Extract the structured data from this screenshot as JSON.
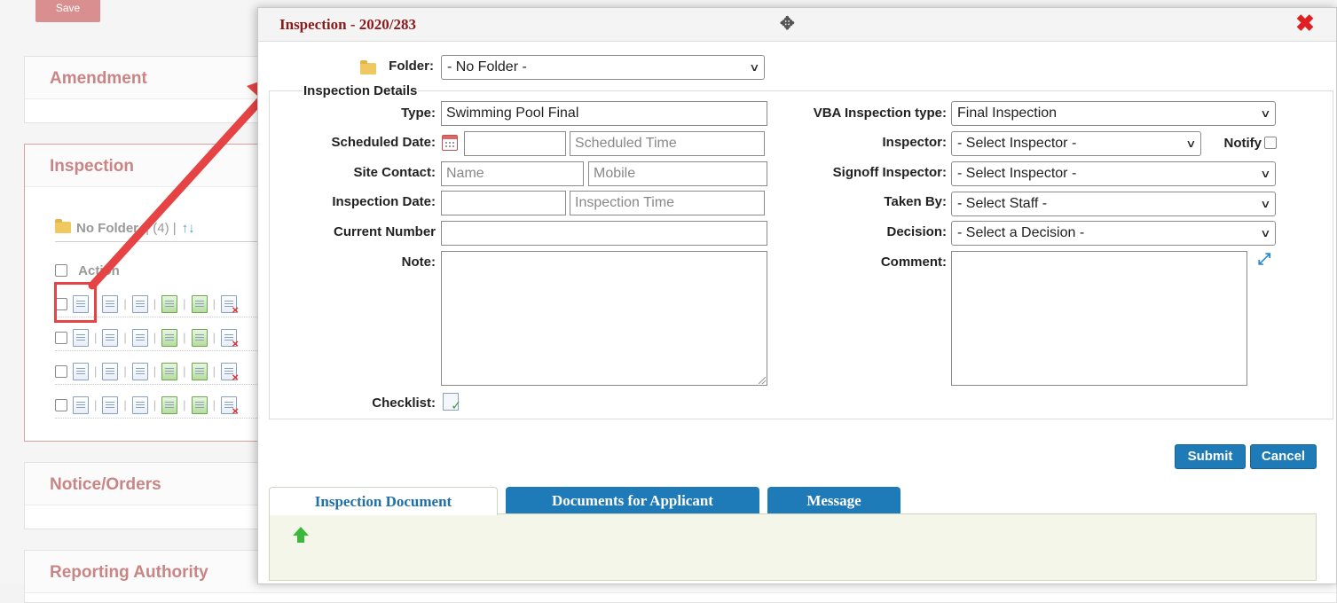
{
  "background": {
    "top_button_label": "Save",
    "panels": [
      {
        "id": "amendment",
        "title": "Amendment"
      },
      {
        "id": "inspection",
        "title": "Inspection"
      },
      {
        "id": "notice",
        "title": "Notice/Orders"
      },
      {
        "id": "reporting",
        "title": "Reporting Authority"
      }
    ],
    "folder_row": {
      "label": "No Folder",
      "count": "(4)",
      "sort_glyph": "↑↓"
    },
    "action_header": "Action",
    "rows": 4
  },
  "modal": {
    "title": "Inspection - 2020/283",
    "folder_label": "Folder:",
    "folder_value": "- No Folder -",
    "section_legend": "Inspection Details",
    "left": {
      "type_label": "Type:",
      "type_value": "Swimming Pool Final",
      "scheduled_date_label": "Scheduled Date:",
      "scheduled_date_value": "",
      "scheduled_time_placeholder": "Scheduled Time",
      "site_contact_label": "Site Contact:",
      "name_placeholder": "Name",
      "mobile_placeholder": "Mobile",
      "inspection_date_label": "Inspection Date:",
      "inspection_time_placeholder": "Inspection Time",
      "current_number_label": "Current Number",
      "note_label": "Note:",
      "checklist_label": "Checklist:"
    },
    "right": {
      "vba_type_label": "VBA Inspection type:",
      "vba_type_value": "Final Inspection",
      "inspector_label": "Inspector:",
      "inspector_value": "- Select Inspector -",
      "notify_label": "Notify",
      "signoff_label": "Signoff Inspector:",
      "signoff_value": "- Select Inspector -",
      "taken_by_label": "Taken By:",
      "taken_by_value": "- Select Staff -",
      "decision_label": "Decision:",
      "decision_value": "- Select a Decision -",
      "comment_label": "Comment:"
    },
    "buttons": {
      "submit": "Submit",
      "cancel": "Cancel"
    },
    "tabs": [
      {
        "label": "Inspection Document",
        "active": true
      },
      {
        "label": "Documents for Applicant",
        "active": false
      },
      {
        "label": "Message",
        "active": false
      }
    ]
  },
  "colors": {
    "accent_blue": "#1f7ab8",
    "title_red": "#8b1a1a",
    "panel_title": "#c98585",
    "highlight_red": "#e64444"
  }
}
